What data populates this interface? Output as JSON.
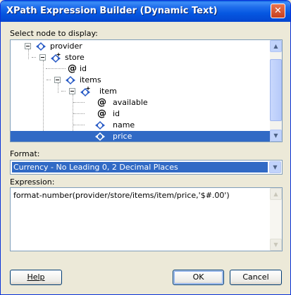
{
  "window": {
    "title": "XPath Expression Builder (Dynamic Text)",
    "close_glyph": "✕"
  },
  "tree": {
    "label": "Select node to display:",
    "nodes": [
      {
        "text": "provider",
        "kind": "element",
        "expanded": true,
        "depth": 0
      },
      {
        "text": "store",
        "kind": "element-repeating",
        "expanded": true,
        "depth": 1
      },
      {
        "text": "id",
        "kind": "attribute",
        "depth": 2
      },
      {
        "text": "items",
        "kind": "element",
        "expanded": true,
        "depth": 2
      },
      {
        "text": "item",
        "kind": "element-repeating",
        "expanded": true,
        "depth": 3
      },
      {
        "text": "available",
        "kind": "attribute",
        "depth": 4
      },
      {
        "text": "id",
        "kind": "attribute",
        "depth": 4
      },
      {
        "text": "name",
        "kind": "element",
        "depth": 4
      },
      {
        "text": "price",
        "kind": "element",
        "depth": 4,
        "selected": true
      }
    ],
    "attribute_glyph": "@",
    "scroll_up_glyph": "▲",
    "scroll_down_glyph": "▼"
  },
  "format": {
    "label": "Format:",
    "selected": "Currency - No Leading 0, 2 Decimal Places",
    "dropdown_glyph": "▼"
  },
  "expression": {
    "label": "Expression:",
    "value": "format-number(provider/store/items/item/price,'$#.00')"
  },
  "buttons": {
    "help": "Help",
    "ok": "OK",
    "cancel": "Cancel"
  },
  "colors": {
    "selection": "#316ac5",
    "titlebar": "#0557e1",
    "element_icon": "#2a5cc6"
  }
}
